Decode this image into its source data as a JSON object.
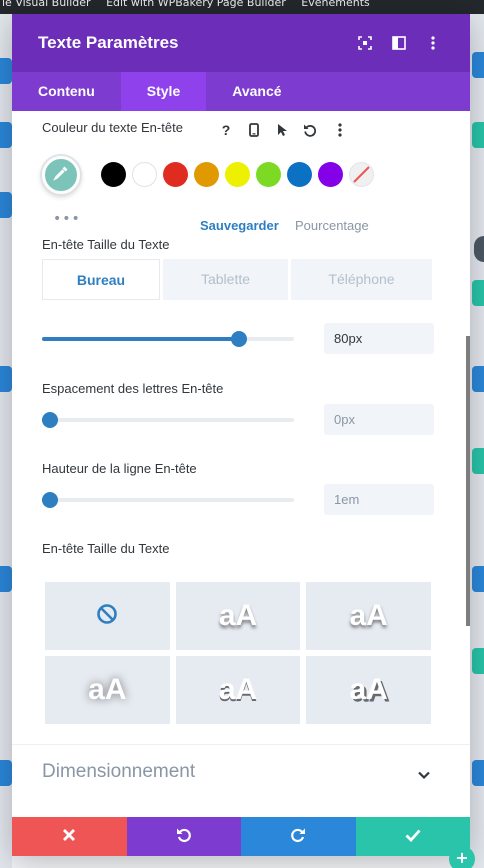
{
  "topbar": {
    "items": [
      "le Visual Builder",
      "Edit with WPBakery Page Builder",
      "Evénements"
    ]
  },
  "modal": {
    "title": "Texte Paramètres",
    "tabs": [
      {
        "label": "Contenu",
        "active": false
      },
      {
        "label": "Style",
        "active": true
      },
      {
        "label": "Avancé",
        "active": false
      }
    ]
  },
  "text_color": {
    "label": "Couleur du texte En-tête",
    "swatches": [
      "#000000",
      "#ffffff",
      "#e02b20",
      "#e09900",
      "#edf000",
      "#7cda24",
      "#0c71c3",
      "#8300e9"
    ],
    "current_color": "#7cc4ba",
    "save_label": "Sauvegarder",
    "percent_label": "Pourcentage",
    "more": "•••"
  },
  "text_size": {
    "label": "En-tête Taille du Texte",
    "devices": [
      {
        "label": "Bureau",
        "active": true
      },
      {
        "label": "Tablette",
        "active": false
      },
      {
        "label": "Téléphone",
        "active": false
      }
    ],
    "value": "80px",
    "slider_fraction": 0.78
  },
  "letter_spacing": {
    "label": "Espacement des lettres En-tête",
    "value": "0px",
    "slider_fraction": 0.03
  },
  "line_height": {
    "label": "Hauteur de la ligne En-tête",
    "value": "1em",
    "slider_fraction": 0.03
  },
  "text_shadow": {
    "label": "En-tête Taille du Texte",
    "sample": "aA",
    "presets": [
      "none",
      "shadow-1",
      "shadow-2",
      "shadow-3",
      "shadow-4",
      "shadow-5"
    ]
  },
  "dimension": {
    "title": "Dimensionnement"
  },
  "colors": {
    "header": "#6c2eb9",
    "tabs": "#7e3bd0",
    "accent": "#2e7fc1",
    "discard": "#ef5555",
    "undo": "#7e3bd0",
    "redo": "#2b87da",
    "save": "#29c4a9"
  },
  "icons": {
    "header": [
      "focus-icon",
      "split-view-icon",
      "more-vertical-icon"
    ],
    "tools": [
      "help-icon",
      "mobile-icon",
      "pointer-icon",
      "reset-icon",
      "more-vertical-icon"
    ],
    "footer": [
      "close-icon",
      "undo-icon",
      "redo-icon",
      "check-icon"
    ]
  }
}
